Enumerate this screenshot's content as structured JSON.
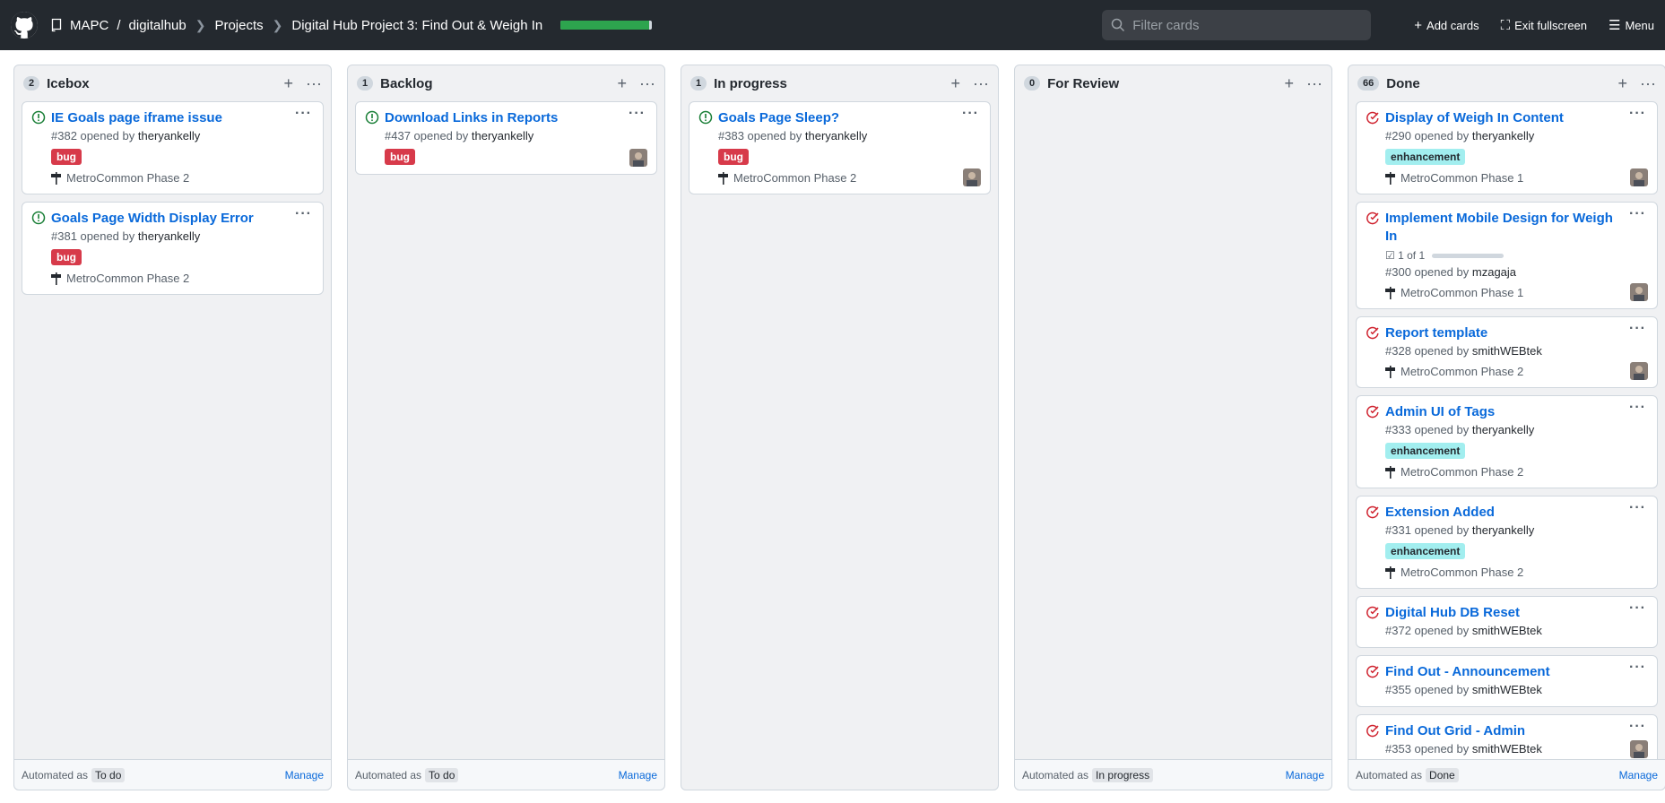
{
  "header": {
    "org": "MAPC",
    "repo": "digitalhub",
    "projects": "Projects",
    "project_name": "Digital Hub Project 3: Find Out & Weigh In",
    "progress_fraction": 0.97,
    "filter_placeholder": "Filter cards",
    "add_cards": "Add cards",
    "exit_fullscreen": "Exit fullscreen",
    "menu": "Menu"
  },
  "columns": [
    {
      "count": "2",
      "title": "Icebox",
      "automated_label": "Automated as",
      "automated_value": "To do",
      "manage": "Manage",
      "cards": [
        {
          "title": "IE Goals page iframe issue",
          "number": "#382 opened by",
          "author": "theryankelly",
          "label": "bug",
          "milestone": "MetroCommon Phase 2"
        },
        {
          "title": "Goals Page Width Display Error",
          "number": "#381 opened by",
          "author": "theryankelly",
          "label": "bug",
          "milestone": "MetroCommon Phase 2"
        }
      ]
    },
    {
      "count": "1",
      "title": "Backlog",
      "automated_label": "Automated as",
      "automated_value": "To do",
      "manage": "Manage",
      "cards": [
        {
          "title": "Download Links in Reports",
          "number": "#437 opened by",
          "author": "theryankelly",
          "label": "bug"
        }
      ]
    },
    {
      "count": "1",
      "title": "In progress",
      "manage": "",
      "cards": [
        {
          "title": "Goals Page Sleep?",
          "number": "#383 opened by",
          "author": "theryankelly",
          "label": "bug",
          "milestone": "MetroCommon Phase 2"
        }
      ]
    },
    {
      "count": "0",
      "title": "For Review",
      "automated_label": "Automated as",
      "automated_value": "In progress",
      "manage": "Manage",
      "cards": []
    },
    {
      "count": "66",
      "title": "Done",
      "automated_label": "Automated as",
      "automated_value": "Done",
      "manage": "Manage",
      "cards": [
        {
          "title": "Display of Weigh In Content",
          "number": "#290 opened by",
          "author": "theryankelly",
          "label": "enhancement",
          "milestone": "MetroCommon Phase 1"
        },
        {
          "title": "Implement Mobile Design for Weigh In",
          "tasks": "1 of 1",
          "number": "#300 opened by",
          "author": "mzagaja",
          "milestone": "MetroCommon Phase 1"
        },
        {
          "title": "Report template",
          "number": "#328 opened by",
          "author": "smithWEBtek",
          "milestone": "MetroCommon Phase 2"
        },
        {
          "title": "Admin UI of Tags",
          "number": "#333 opened by",
          "author": "theryankelly",
          "label": "enhancement",
          "milestone": "MetroCommon Phase 2"
        },
        {
          "title": "Extension Added",
          "number": "#331 opened by",
          "author": "theryankelly",
          "label": "enhancement",
          "milestone": "MetroCommon Phase 2"
        },
        {
          "title": "Digital Hub DB Reset",
          "number": "#372 opened by",
          "author": "smithWEBtek"
        },
        {
          "title": "Find Out - Announcement",
          "number": "#355 opened by",
          "author": "smithWEBtek"
        },
        {
          "title": "Find Out Grid - Admin",
          "number": "#353 opened by",
          "author": "smithWEBtek"
        }
      ]
    }
  ],
  "colors": {
    "open": "#1a7f37",
    "closed": "#cf222e",
    "link": "#0969da",
    "header_bg": "#24292f"
  }
}
